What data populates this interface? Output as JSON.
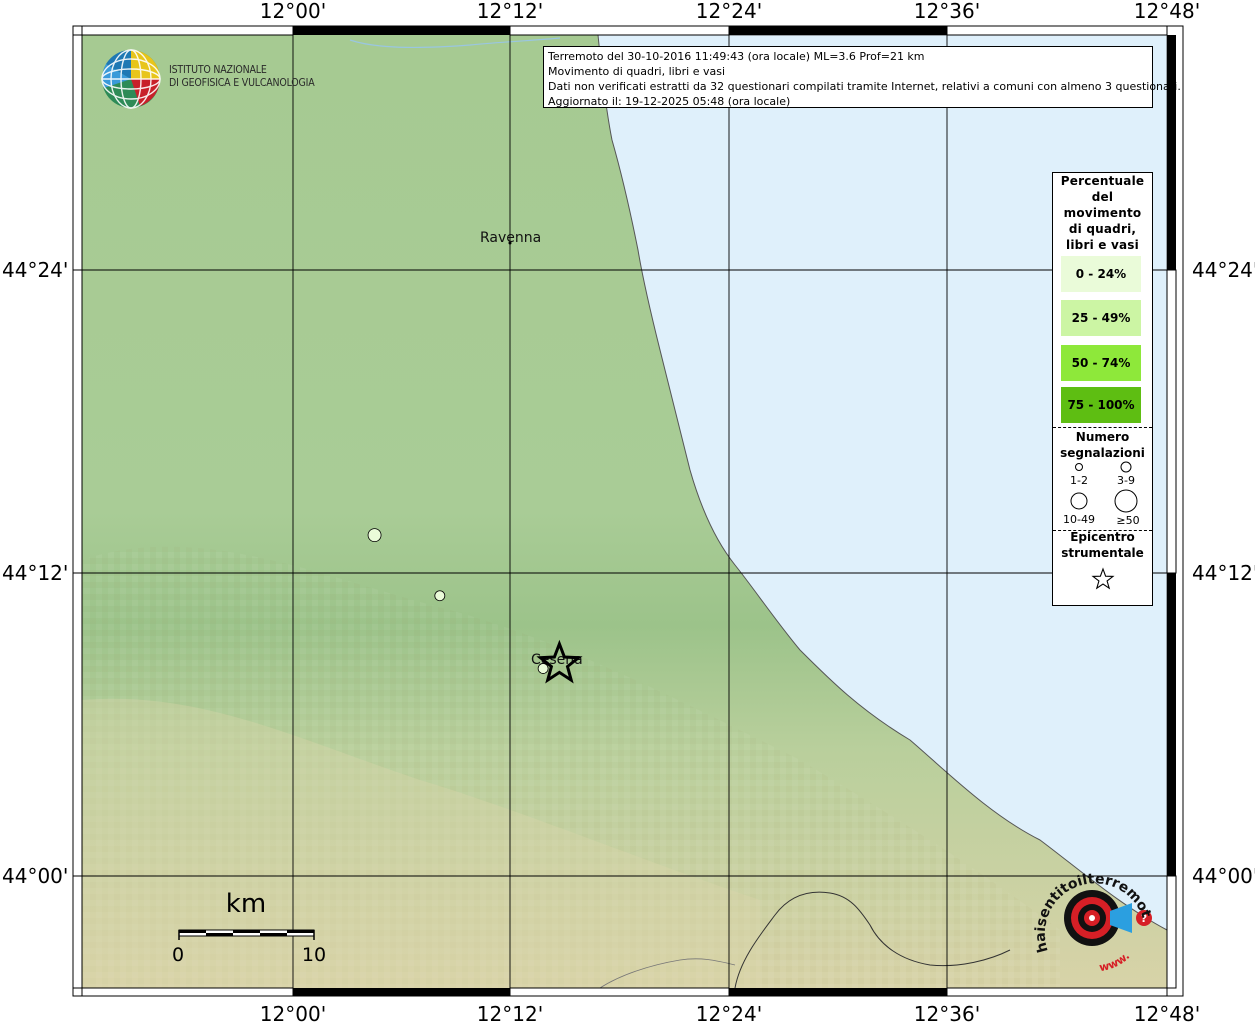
{
  "event": {
    "line1": "Terremoto del 30-10-2016 11:49:43 (ora locale) ML=3.6 Prof=21 km",
    "line2": "Movimento di quadri, libri e vasi",
    "line3": "Dati non verificati estratti da 32 questionari compilati tramite Internet, relativi a comuni con almeno 3 questionari.",
    "line4": "Aggiornato il: 19-12-2025 05:48 (ora locale)"
  },
  "logo": {
    "line1": "ISTITUTO NAZIONALE",
    "line2": "DI GEOFISICA E VULCANOLOGIA"
  },
  "axes": {
    "longitude_ticks": [
      "12°00'",
      "12°12'",
      "12°24'",
      "12°36'",
      "12°48'"
    ],
    "latitude_ticks": [
      "44°24'",
      "44°12'",
      "44°00'"
    ]
  },
  "places": [
    {
      "name": "Ravenna"
    },
    {
      "name": "Cesena"
    }
  ],
  "legend": {
    "title": "Percentuale del movimento di quadri, libri e vasi",
    "title_lines": [
      "Percentuale",
      "del",
      "movimento",
      "di quadri,",
      "libri e vasi"
    ],
    "classes": [
      {
        "label": "0 - 24%",
        "color": "#eafbd9"
      },
      {
        "label": "25 - 49%",
        "color": "#ccf5a4"
      },
      {
        "label": "50 - 74%",
        "color": "#8ee83a"
      },
      {
        "label": "75 - 100%",
        "color": "#5ebe12"
      }
    ],
    "count_title_lines": [
      "Numero",
      "segnalazioni"
    ],
    "count_classes": [
      "1-2",
      "3-9",
      "10-49",
      "≥50"
    ],
    "epicenter_title_lines": [
      "Epicentro",
      "strumentale"
    ]
  },
  "scale_bar": {
    "unit": "km",
    "start": "0",
    "end": "10"
  },
  "observations": [
    {
      "lon": 12.075,
      "lat": 44.225,
      "count_class": "3-9",
      "percent_class": "0 - 24%"
    },
    {
      "lon": 12.135,
      "lat": 44.185,
      "count_class": "1-2",
      "percent_class": "0 - 24%"
    },
    {
      "lon": 12.23,
      "lat": 44.137,
      "count_class": "1-2",
      "percent_class": "0 - 24%"
    }
  ],
  "epicenter": {
    "lon": 12.245,
    "lat": 44.14
  },
  "watermark": {
    "text_top": "haisentitoilterremoto.it",
    "text_bottom": "www."
  },
  "colors": {
    "sea": "#dff0fb",
    "land": "#a9cc96",
    "grid": "#000000"
  }
}
